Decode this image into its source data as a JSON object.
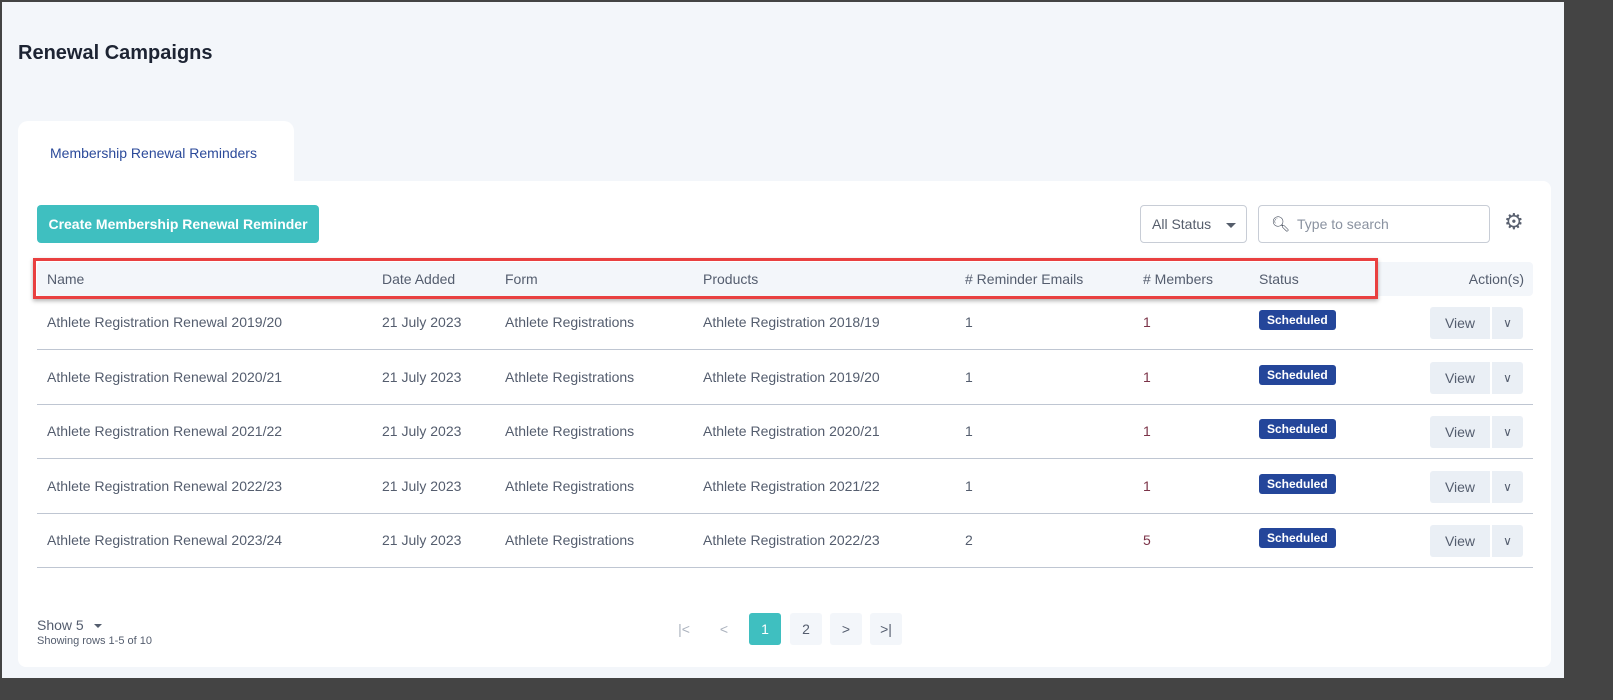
{
  "page_title": "Renewal Campaigns",
  "tab": "Membership Renewal Reminders",
  "create_button": "Create Membership Renewal Reminder",
  "status_filter": "All Status",
  "search_placeholder": "Type to search",
  "columns": [
    "Name",
    "Date Added",
    "Form",
    "Products",
    "# Reminder Emails",
    "# Members",
    "Status",
    "Action(s)"
  ],
  "rows": [
    {
      "name": "Athlete Registration Renewal 2019/20",
      "date": "21 July 2023",
      "form": "Athlete Registrations",
      "product": "Athlete Registration 2018/19",
      "emails": "1",
      "members": "1",
      "status": "Scheduled"
    },
    {
      "name": "Athlete Registration Renewal 2020/21",
      "date": "21 July 2023",
      "form": "Athlete Registrations",
      "product": "Athlete Registration 2019/20",
      "emails": "1",
      "members": "1",
      "status": "Scheduled"
    },
    {
      "name": "Athlete Registration Renewal 2021/22",
      "date": "21 July 2023",
      "form": "Athlete Registrations",
      "product": "Athlete Registration 2020/21",
      "emails": "1",
      "members": "1",
      "status": "Scheduled"
    },
    {
      "name": "Athlete Registration Renewal 2022/23",
      "date": "21 July 2023",
      "form": "Athlete Registrations",
      "product": "Athlete Registration 2021/22",
      "emails": "1",
      "members": "1",
      "status": "Scheduled"
    },
    {
      "name": "Athlete Registration Renewal 2023/24",
      "date": "21 July 2023",
      "form": "Athlete Registrations",
      "product": "Athlete Registration 2022/23",
      "emails": "2",
      "members": "5",
      "status": "Scheduled"
    }
  ],
  "view_label": "View",
  "show_label": "Show 5",
  "rows_info": "Showing rows 1-5 of 10",
  "pagination": {
    "first": "|<",
    "prev": "<",
    "pages": [
      "1",
      "2"
    ],
    "current": "1",
    "next": ">",
    "last": ">|"
  },
  "colors": {
    "accent": "#3fbfc0",
    "badge": "#24469a",
    "highlight": "#e94040"
  }
}
